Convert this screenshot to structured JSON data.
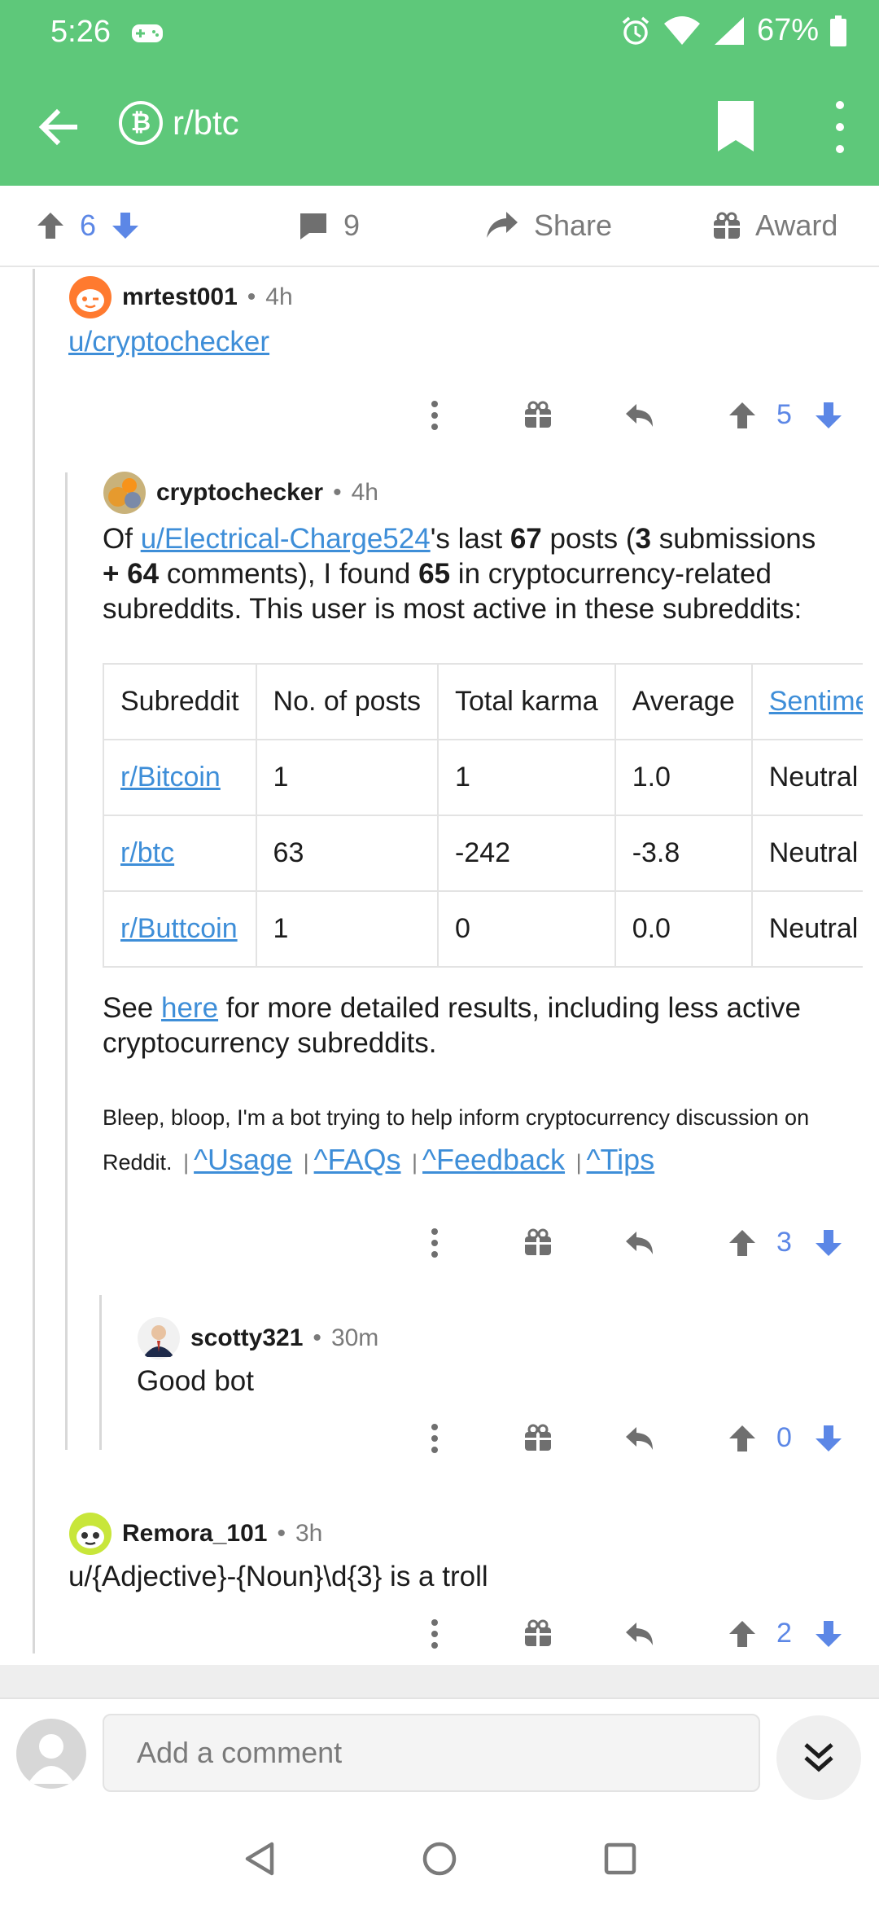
{
  "status": {
    "time": "5:26",
    "battery": "67%"
  },
  "app_bar": {
    "subreddit": "r/btc",
    "coin_glyph": "₿"
  },
  "post_actions": {
    "score": "6",
    "comments": "9",
    "share_label": "Share",
    "award_label": "Award"
  },
  "comments": [
    {
      "user": "mrtest001",
      "age": "4h",
      "text_link": "u/cryptochecker",
      "score": "5"
    },
    {
      "user": "cryptochecker",
      "age": "4h",
      "intro": {
        "p1": "Of ",
        "user_link": "u/Electrical-Charge524",
        "p2": "'s last ",
        "n_posts": "67",
        "p3": " posts (",
        "n_sub": "3",
        "p4": " submissions ",
        "plus": "+ ",
        "n_com": "64",
        "p5": " comments), I found ",
        "n_found": "65",
        "p6": " in cryptocurrency-related subreddits. This user is most active in these subreddits:"
      },
      "table": {
        "headers": [
          "Subreddit",
          "No. of posts",
          "Total karma",
          "Average",
          "Sentiment"
        ],
        "rows": [
          [
            "r/Bitcoin",
            "1",
            "1",
            "1.0",
            "Neutral"
          ],
          [
            "r/btc",
            "63",
            "-242",
            "-3.8",
            "Neutral"
          ],
          [
            "r/Buttcoin",
            "1",
            "0",
            "0.0",
            "Neutral"
          ]
        ]
      },
      "see_more": {
        "p1": "See ",
        "link": "here",
        "p2": " for more detailed results, including less active cryptocurrency subreddits."
      },
      "bot_note": "Bleep, bloop, I'm a bot trying to help inform cryptocurrency discussion on Reddit.",
      "bot_links": [
        "^Usage",
        "^FAQs",
        "^Feedback",
        "^Tips"
      ],
      "score": "3"
    },
    {
      "user": "scotty321",
      "age": "30m",
      "text": "Good bot",
      "score": "0"
    },
    {
      "user": "Remora_101",
      "age": "3h",
      "text": "u/{Adjective}-{Noun}\\d{3} is a troll",
      "score": "2"
    }
  ],
  "composer": {
    "placeholder": "Add a comment"
  },
  "colors": {
    "header": "#5ec87a",
    "vote": "#5c87e6",
    "link": "#3e8ed8"
  }
}
